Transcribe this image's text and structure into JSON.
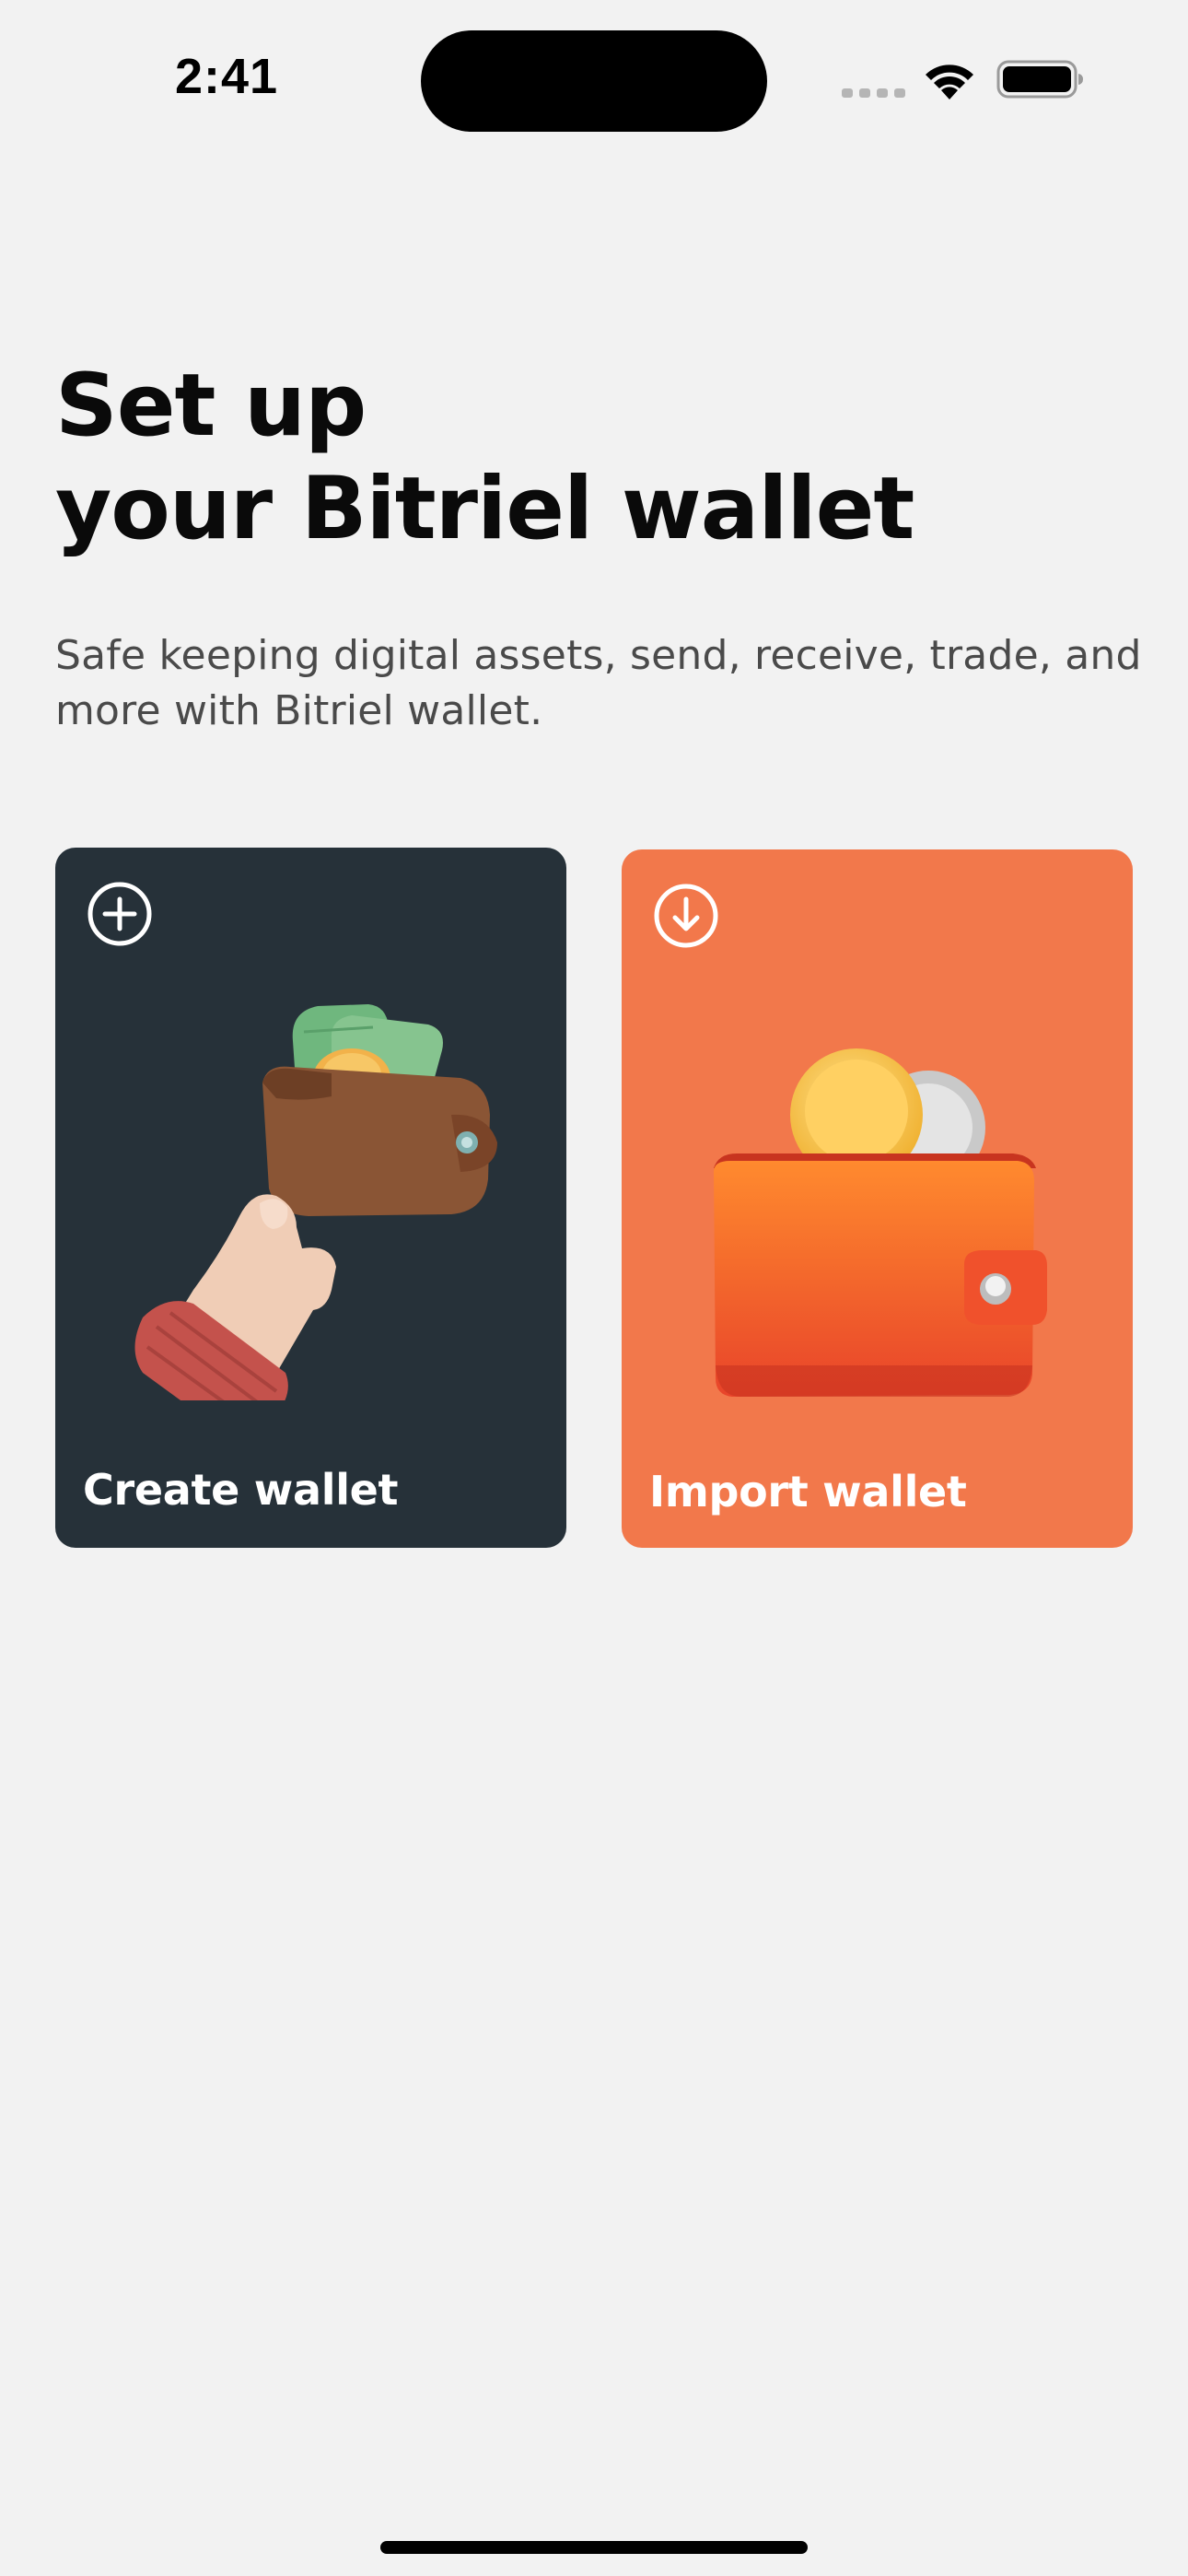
{
  "status_bar": {
    "time": "2:41"
  },
  "header": {
    "title_line1": "Set up",
    "title_line2": "your Bitriel wallet",
    "subtitle": "Safe keeping digital assets, send, receive, trade, and more with Bitriel wallet."
  },
  "cards": [
    {
      "label": "Create wallet",
      "icon": "plus-circle-icon",
      "color": "#263139"
    },
    {
      "label": "Import wallet",
      "icon": "download-circle-icon",
      "color": "#f2784b"
    }
  ]
}
